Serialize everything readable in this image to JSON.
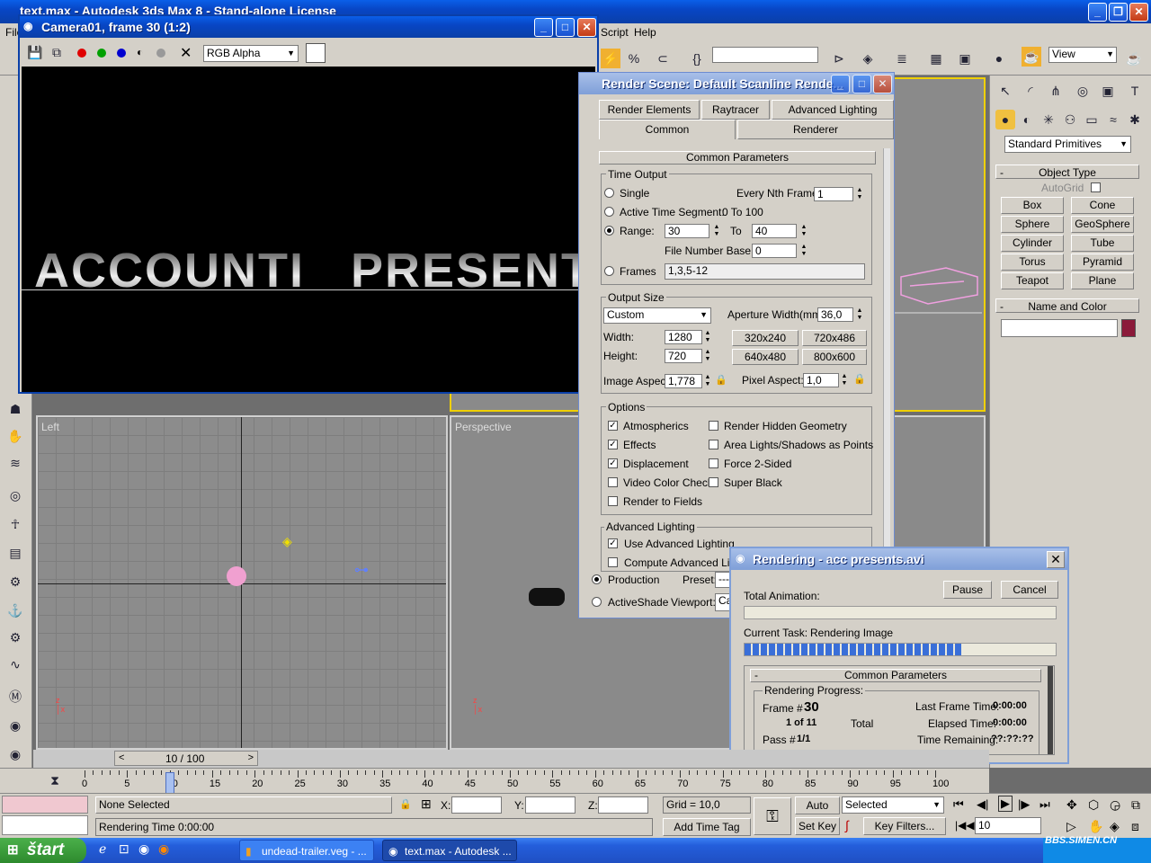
{
  "max": {
    "title": "text.max - Autodesk 3ds Max 8 - Stand-alone License",
    "menu": [
      "File",
      "Script",
      "Help"
    ],
    "view_dropdown": "View",
    "standard_primitives": "Standard Primitives",
    "object_type": {
      "header": "Object Type",
      "autogrid": "AutoGrid",
      "buttons": [
        "Box",
        "Cone",
        "Sphere",
        "GeoSphere",
        "Cylinder",
        "Tube",
        "Torus",
        "Pyramid",
        "Teapot",
        "Plane"
      ]
    },
    "name_color": {
      "header": "Name and Color",
      "color": "#8b1a3a"
    },
    "viewports": {
      "left": "Left",
      "perspective": "Perspective"
    },
    "time_slider": "10 / 100",
    "ruler_ticks": [
      "0",
      "5",
      "10",
      "15",
      "20",
      "25",
      "30",
      "35",
      "40",
      "45",
      "50",
      "55",
      "60",
      "65",
      "70",
      "75",
      "80",
      "85",
      "90",
      "95",
      "100"
    ],
    "status": {
      "selection": "None Selected",
      "x_label": "X:",
      "y_label": "Y:",
      "z_label": "Z:",
      "grid": "Grid = 10,0",
      "prompt": "Rendering Time  0:00:00",
      "add_time_tag": "Add Time Tag",
      "auto_key": "Auto Key",
      "set_key": "Set Key",
      "selected": "Selected",
      "key_filters": "Key Filters...",
      "frame": "10"
    }
  },
  "frame_window": {
    "title": "Camera01, frame 30 (1:2)",
    "channel": "RGB Alpha",
    "render_text": "ACCOUNTI   PRESENTS"
  },
  "render_scene": {
    "title": "Render Scene: Default Scanline Rende...",
    "tabs_row1": [
      "Render Elements",
      "Raytracer",
      "Advanced Lighting"
    ],
    "tabs_row2": [
      "Common",
      "Renderer"
    ],
    "rollout": "Common Parameters",
    "time_output": {
      "label": "Time Output",
      "single": "Single",
      "every_nth": "Every Nth Frame:",
      "every_nth_value": "1",
      "active_segment": "Active Time Segment:",
      "segment_value": "0 To 100",
      "range": "Range:",
      "range_from": "30",
      "to": "To",
      "range_to": "40",
      "file_number_base": "File Number Base:",
      "file_number_value": "0",
      "frames": "Frames",
      "frames_value": "1,3,5-12"
    },
    "output_size": {
      "label": "Output Size",
      "preset": "Custom",
      "aperture": "Aperture Width(mm):",
      "aperture_value": "36,0",
      "width": "Width:",
      "width_value": "1280",
      "height": "Height:",
      "height_value": "720",
      "sizes": [
        "320x240",
        "720x486",
        "640x480",
        "800x600"
      ],
      "image_aspect": "Image Aspect:",
      "image_aspect_value": "1,778",
      "pixel_aspect": "Pixel Aspect:",
      "pixel_aspect_value": "1,0"
    },
    "options": {
      "label": "Options",
      "items": [
        {
          "text": "Atmospherics",
          "checked": true
        },
        {
          "text": "Render Hidden Geometry",
          "checked": false
        },
        {
          "text": "Effects",
          "checked": true
        },
        {
          "text": "Area Lights/Shadows as Points",
          "checked": false
        },
        {
          "text": "Displacement",
          "checked": true
        },
        {
          "text": "Force 2-Sided",
          "checked": false
        },
        {
          "text": "Video Color Check",
          "checked": false
        },
        {
          "text": "Super Black",
          "checked": false
        },
        {
          "text": "Render to Fields",
          "checked": false
        }
      ]
    },
    "advanced_lighting": {
      "label": "Advanced Lighting",
      "use": "Use Advanced Lighting",
      "compute": "Compute Advanced Ligh"
    },
    "bottom": {
      "production": "Production",
      "preset": "Preset:",
      "preset_value": "----",
      "activeshade": "ActiveShade",
      "viewport": "Viewport:",
      "viewport_value": "Ca"
    }
  },
  "rendering_dialog": {
    "title": "Rendering - acc presents.avi",
    "total_animation": "Total Animation:",
    "pause": "Pause",
    "cancel": "Cancel",
    "current_task_label": "Current Task:",
    "current_task": "Rendering Image",
    "task_progress": 0.7,
    "rollout": "Common Parameters",
    "progress_label": "Rendering Progress:",
    "frame_label": "Frame #",
    "frame_value": "30",
    "count": "1 of 11",
    "total": "Total",
    "pass_label": "Pass #",
    "pass_value": "1/1",
    "last_frame_label": "Last Frame Time:",
    "last_frame": "0:00:00",
    "elapsed_label": "Elapsed Time:",
    "elapsed": "0:00:00",
    "remaining_label": "Time Remaining:",
    "remaining": "??:??:??"
  },
  "taskbar": {
    "start": "štart",
    "tasks": [
      "undead-trailer.veg - ...",
      "text.max - Autodesk ..."
    ],
    "watermark": "BBS.SIMEN.CN"
  }
}
